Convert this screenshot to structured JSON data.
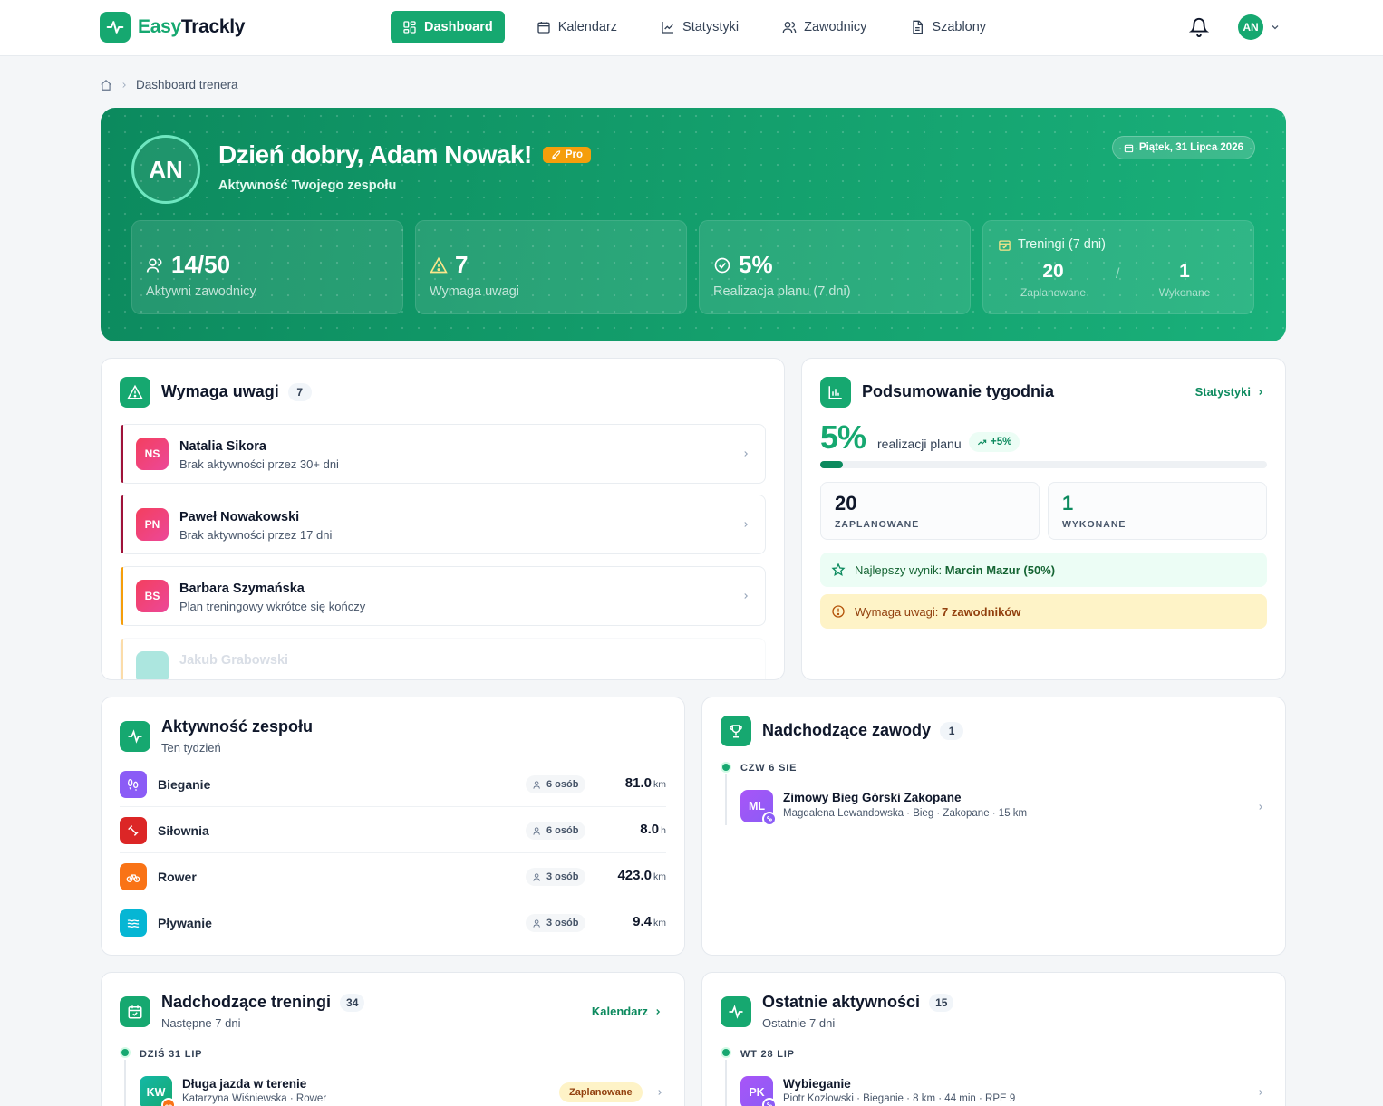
{
  "app": {
    "logo_easy": "Easy",
    "logo_trackly": "Trackly",
    "accent": "#16a870"
  },
  "nav": [
    {
      "label": "Dashboard",
      "icon": "grid-icon",
      "active": true
    },
    {
      "label": "Kalendarz",
      "icon": "calendar-icon"
    },
    {
      "label": "Statystyki",
      "icon": "chart-line-icon"
    },
    {
      "label": "Zawodnicy",
      "icon": "users-icon"
    },
    {
      "label": "Szablony",
      "icon": "document-icon"
    }
  ],
  "user": {
    "initials": "AN"
  },
  "breadcrumb": {
    "current": "Dashboard trenera"
  },
  "hero": {
    "initials": "AN",
    "greeting": "Dzień dobry, Adam Nowak!",
    "badge": "Pro",
    "subtitle": "Aktywność Twojego zespołu",
    "date": "Piątek, 31 Lipca 2026",
    "stats": [
      {
        "value": "14/50",
        "label": "Aktywni zawodnicy"
      },
      {
        "value": "7",
        "label": "Wymaga uwagi"
      },
      {
        "value": "5%",
        "label": "Realizacja planu (7 dni)"
      }
    ],
    "trainings": {
      "title": "Treningi (7 dni)",
      "planned": "20",
      "planned_label": "Zaplanowane",
      "done": "1",
      "done_label": "Wykonane",
      "sep": "/"
    }
  },
  "attention": {
    "title": "Wymaga uwagi",
    "count": "7",
    "items": [
      {
        "initials": "NS",
        "name": "Natalia Sikora",
        "desc": "Brak aktywności przez 30+ dni",
        "color": "#e11d48"
      },
      {
        "initials": "PN",
        "name": "Paweł Nowakowski",
        "desc": "Brak aktywności przez 17 dni",
        "color": "#e11d48"
      },
      {
        "initials": "BS",
        "name": "Barbara Szymańska",
        "desc": "Plan treningowy wkrótce się kończy",
        "color": "#f59e0b"
      },
      {
        "initials": "",
        "name": "Jakub Grabowski",
        "desc": "",
        "color": "#f59e0b"
      }
    ]
  },
  "week": {
    "title": "Podsumowanie tygodnia",
    "link": "Statystyki",
    "percent": "5%",
    "percent_value": 5,
    "percent_label": "realizacji planu",
    "trend": "+5%",
    "planned": "20",
    "planned_label": "ZAPLANOWANE",
    "done": "1",
    "done_label": "WYKONANE",
    "best_prefix": "Najlepszy wynik:",
    "best_value": "Marcin Mazur (50%)",
    "warn_prefix": "Wymaga uwagi:",
    "warn_value": "7 zawodników"
  },
  "activity": {
    "title": "Aktywność zespołu",
    "subtitle": "Ten tydzień",
    "rows": [
      {
        "name": "Bieganie",
        "people": "6 osób",
        "value": "81.0",
        "unit": "km",
        "color": "#8b5cf6",
        "icon": "footprints-icon"
      },
      {
        "name": "Siłownia",
        "people": "6 osób",
        "value": "8.0",
        "unit": "h",
        "color": "#dc2626",
        "icon": "dumbbell-icon"
      },
      {
        "name": "Rower",
        "people": "3 osób",
        "value": "423.0",
        "unit": "km",
        "color": "#f97316",
        "icon": "bike-icon"
      },
      {
        "name": "Pływanie",
        "people": "3 osób",
        "value": "9.4",
        "unit": "km",
        "color": "#06b6d4",
        "icon": "waves-icon"
      }
    ]
  },
  "competitions": {
    "title": "Nadchodzące zawody",
    "count": "1",
    "date": "CZW 6 SIE",
    "item": {
      "initials": "ML",
      "title": "Zimowy Bieg Górski Zakopane",
      "meta": "Magdalena Lewandowska · Bieg · Zakopane · 15 km"
    }
  },
  "trainings": {
    "title": "Nadchodzące treningi",
    "count": "34",
    "subtitle": "Następne 7 dni",
    "link": "Kalendarz",
    "date": "DZIŚ 31 LIP",
    "item": {
      "initials": "KW",
      "title": "Długa jazda w terenie",
      "meta": "Katarzyna Wiśniewska · Rower",
      "status": "Zaplanowane"
    }
  },
  "recent": {
    "title": "Ostatnie aktywności",
    "count": "15",
    "subtitle": "Ostatnie 7 dni",
    "date": "WT 28 LIP",
    "item": {
      "initials": "PK",
      "title": "Wybieganie",
      "meta": "Piotr Kozłowski · Bieganie · 8 km · 44 min · RPE 9"
    }
  }
}
